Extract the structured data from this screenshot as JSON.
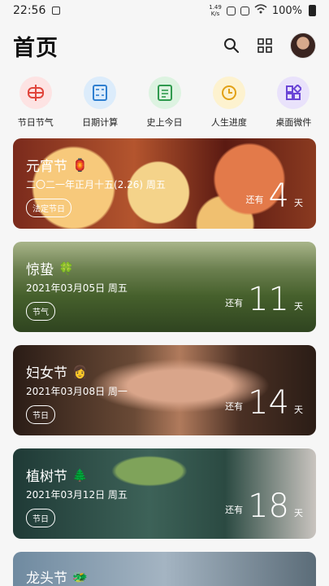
{
  "status": {
    "time": "22:56",
    "speed_top": "1.49",
    "speed_bottom": "K/s",
    "battery": "100%"
  },
  "header": {
    "title": "首页"
  },
  "tools": [
    {
      "label": "节日节气",
      "bg": "#fde3e3",
      "color": "#e0453c"
    },
    {
      "label": "日期计算",
      "bg": "#dcecfb",
      "color": "#2f7fd0"
    },
    {
      "label": "史上今日",
      "bg": "#ddf3e1",
      "color": "#2f9a4e"
    },
    {
      "label": "人生进度",
      "bg": "#fdf2cf",
      "color": "#e2a116"
    },
    {
      "label": "桌面微件",
      "bg": "#e9e2fb",
      "color": "#6a45d6"
    }
  ],
  "cards": [
    {
      "name": "元宵节",
      "emoji": "🏮",
      "date": "二〇二一年正月十五(2.26) 周五",
      "tag": "法定节日",
      "pre": "还有",
      "num": "4",
      "post": "天"
    },
    {
      "name": "惊蛰",
      "emoji": "🍀",
      "date": "2021年03月05日 周五",
      "tag": "节气",
      "pre": "还有",
      "num": "11",
      "post": "天"
    },
    {
      "name": "妇女节",
      "emoji": "👩",
      "date": "2021年03月08日 周一",
      "tag": "节日",
      "pre": "还有",
      "num": "14",
      "post": "天"
    },
    {
      "name": "植树节",
      "emoji": "🌲",
      "date": "2021年03月12日 周五",
      "tag": "节日",
      "pre": "还有",
      "num": "18",
      "post": "天"
    },
    {
      "name": "龙头节",
      "emoji": "🐲"
    }
  ]
}
